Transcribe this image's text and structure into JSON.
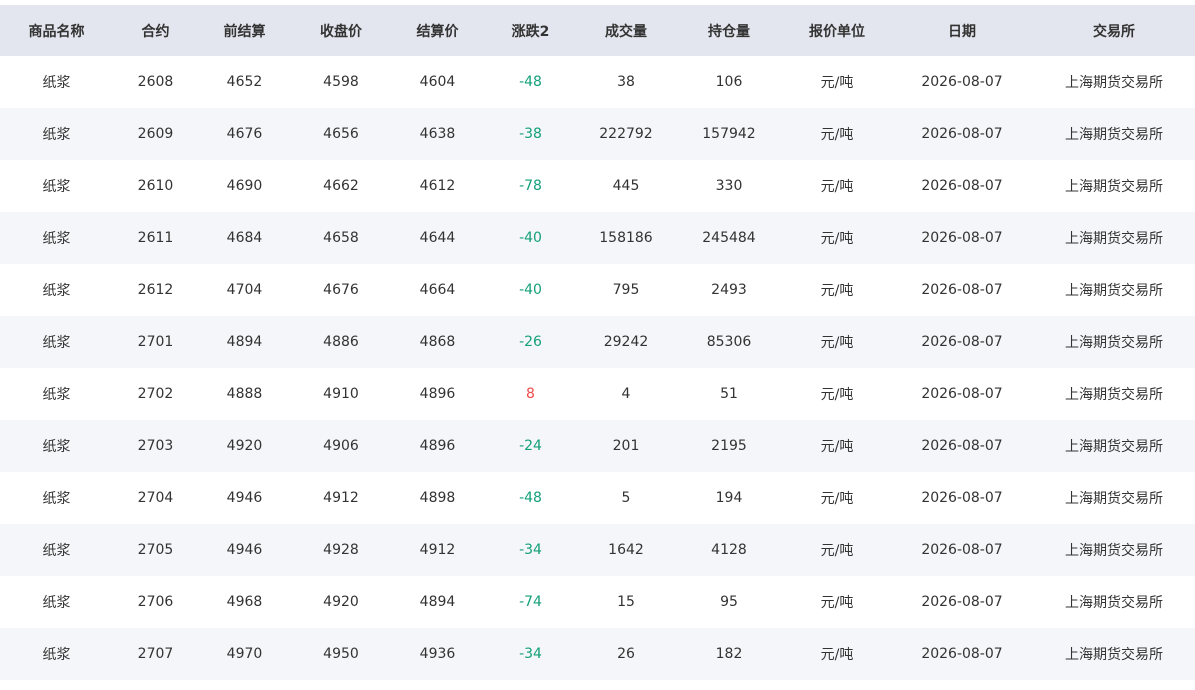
{
  "table": {
    "headers": [
      "商品名称",
      "合约",
      "前结算",
      "收盘价",
      "结算价",
      "涨跌2",
      "成交量",
      "持仓量",
      "报价单位",
      "日期",
      "交易所"
    ],
    "rows": [
      [
        "纸浆",
        "2608",
        "4652",
        "4598",
        "4604",
        "-48",
        "38",
        "106",
        "元/吨",
        "2026-08-07",
        "上海期货交易所"
      ],
      [
        "纸浆",
        "2609",
        "4676",
        "4656",
        "4638",
        "-38",
        "222792",
        "157942",
        "元/吨",
        "2026-08-07",
        "上海期货交易所"
      ],
      [
        "纸浆",
        "2610",
        "4690",
        "4662",
        "4612",
        "-78",
        "445",
        "330",
        "元/吨",
        "2026-08-07",
        "上海期货交易所"
      ],
      [
        "纸浆",
        "2611",
        "4684",
        "4658",
        "4644",
        "-40",
        "158186",
        "245484",
        "元/吨",
        "2026-08-07",
        "上海期货交易所"
      ],
      [
        "纸浆",
        "2612",
        "4704",
        "4676",
        "4664",
        "-40",
        "795",
        "2493",
        "元/吨",
        "2026-08-07",
        "上海期货交易所"
      ],
      [
        "纸浆",
        "2701",
        "4894",
        "4886",
        "4868",
        "-26",
        "29242",
        "85306",
        "元/吨",
        "2026-08-07",
        "上海期货交易所"
      ],
      [
        "纸浆",
        "2702",
        "4888",
        "4910",
        "4896",
        "8",
        "4",
        "51",
        "元/吨",
        "2026-08-07",
        "上海期货交易所"
      ],
      [
        "纸浆",
        "2703",
        "4920",
        "4906",
        "4896",
        "-24",
        "201",
        "2195",
        "元/吨",
        "2026-08-07",
        "上海期货交易所"
      ],
      [
        "纸浆",
        "2704",
        "4946",
        "4912",
        "4898",
        "-48",
        "5",
        "194",
        "元/吨",
        "2026-08-07",
        "上海期货交易所"
      ],
      [
        "纸浆",
        "2705",
        "4946",
        "4928",
        "4912",
        "-34",
        "1642",
        "4128",
        "元/吨",
        "2026-08-07",
        "上海期货交易所"
      ],
      [
        "纸浆",
        "2706",
        "4968",
        "4920",
        "4894",
        "-74",
        "15",
        "95",
        "元/吨",
        "2026-08-07",
        "上海期货交易所"
      ],
      [
        "纸浆",
        "2707",
        "4970",
        "4950",
        "4936",
        "-34",
        "26",
        "182",
        "元/吨",
        "2026-08-07",
        "上海期货交易所"
      ]
    ]
  },
  "colors": {
    "header_bg": "#e3e6ee",
    "stripe_bg": "#f4f6f9",
    "down": "#14a07a",
    "up": "#f04a4a"
  }
}
